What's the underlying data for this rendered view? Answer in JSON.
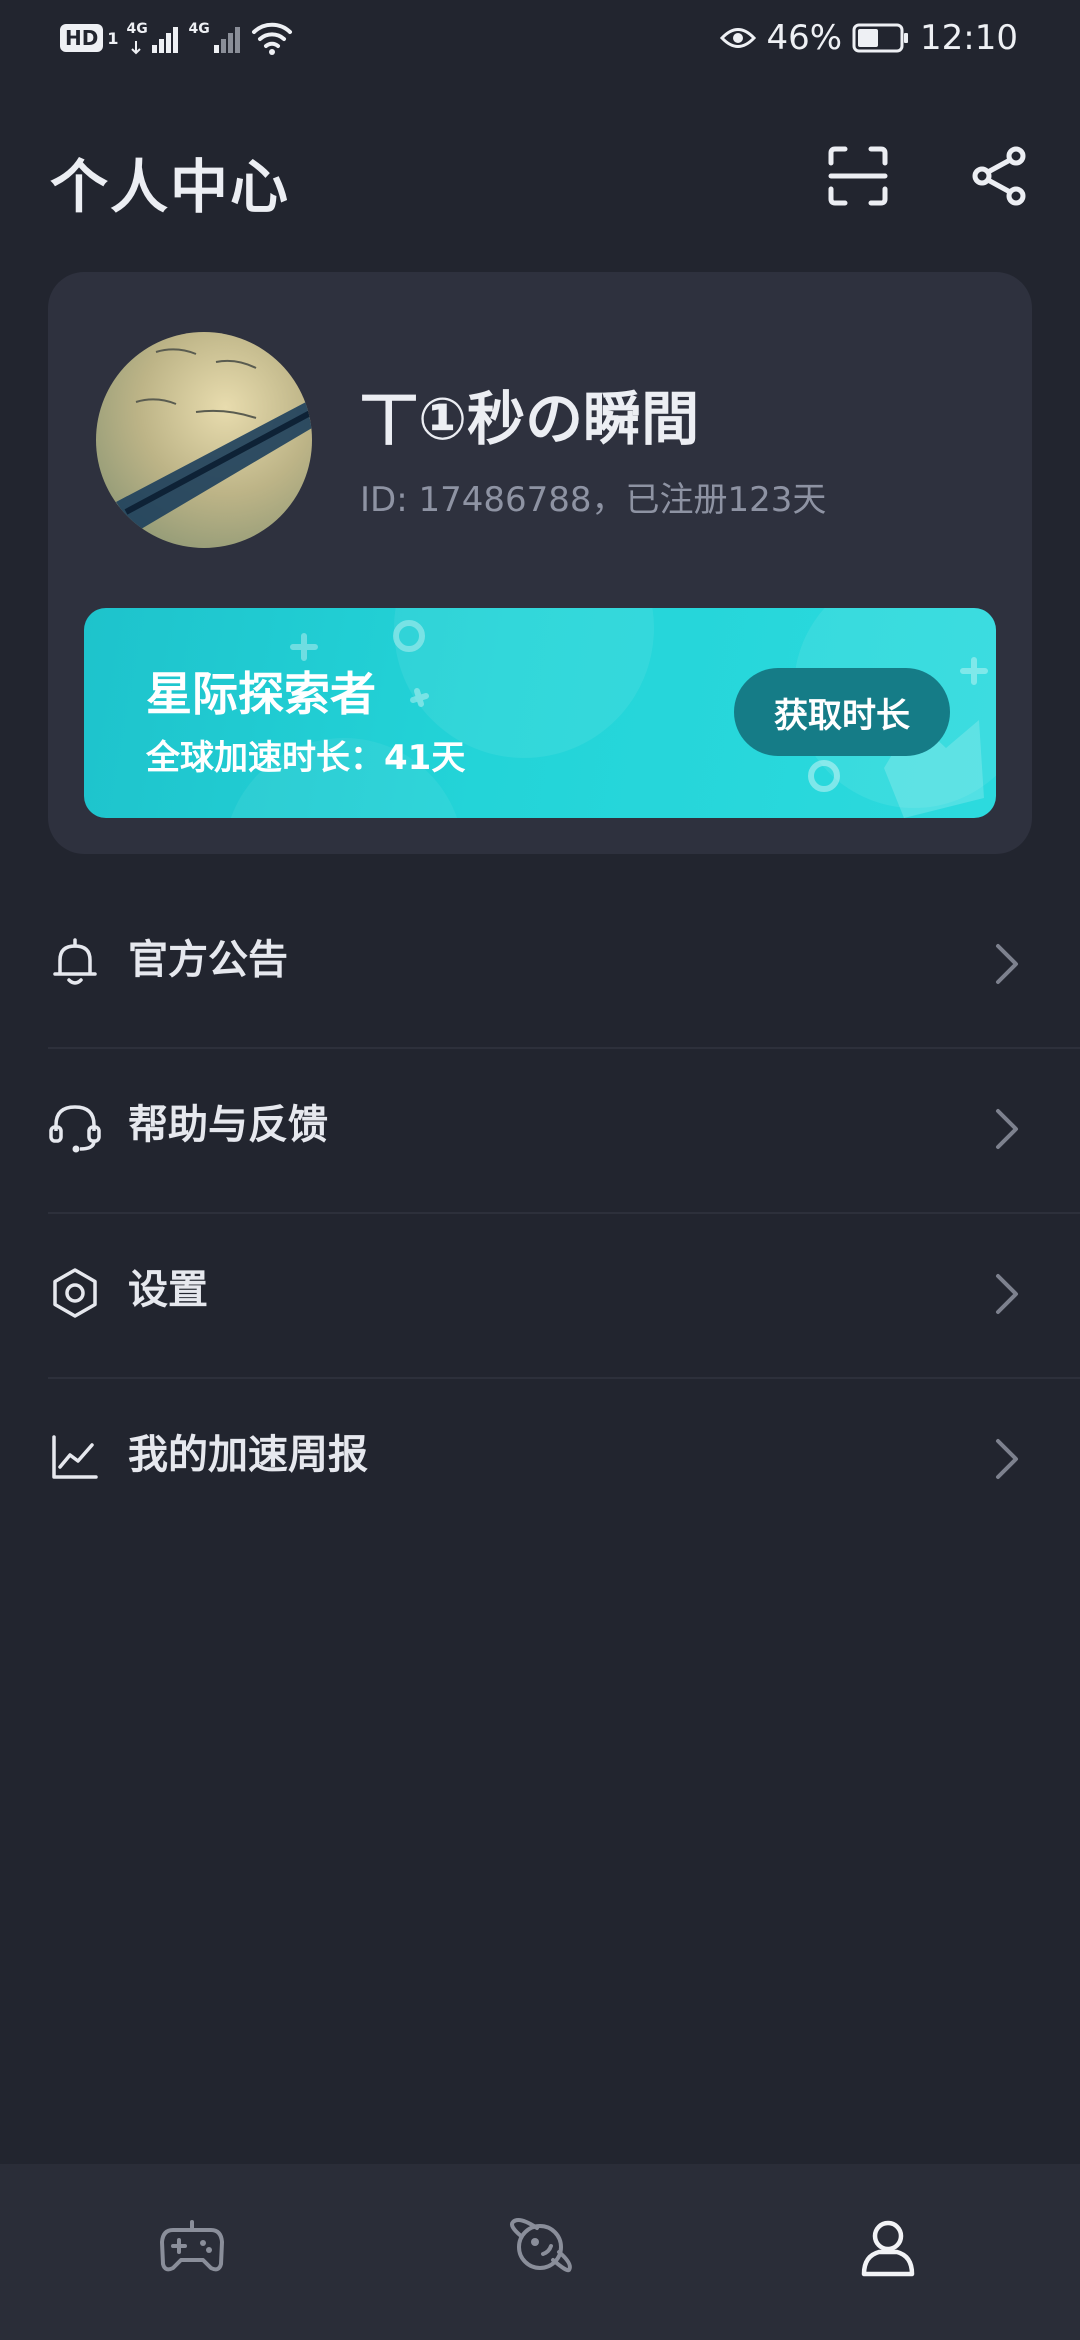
{
  "status_bar": {
    "hd_label": "HD",
    "sim_number": "1",
    "network_1": "4G",
    "network_2": "4G",
    "battery_percent": "46%",
    "time": "12:10",
    "icons": [
      "signal-icon",
      "wifi-icon",
      "eye-icon",
      "battery-icon"
    ]
  },
  "header": {
    "title": "个人中心",
    "scan_icon": "scan-icon",
    "share_icon": "share-icon"
  },
  "profile": {
    "username": "丅①秒の瞬間",
    "id_text": "ID: 17486788，已注册123天",
    "avatar_icon": "avatar-photo"
  },
  "vip": {
    "title": "星际探索者",
    "subtitle": "全球加速时长：41天",
    "button_label": "获取时长",
    "accent_color": "#23d4d8",
    "button_color": "#157c87"
  },
  "menu": {
    "items": [
      {
        "label": "官方公告",
        "icon": "bell-icon"
      },
      {
        "label": "帮助与反馈",
        "icon": "headset-icon"
      },
      {
        "label": "设置",
        "icon": "settings-icon"
      },
      {
        "label": "我的加速周报",
        "icon": "chart-icon"
      }
    ]
  },
  "bottom_nav": {
    "tabs": [
      {
        "icon": "gamepad-icon",
        "active": false
      },
      {
        "icon": "planet-icon",
        "active": false
      },
      {
        "icon": "user-icon",
        "active": true
      }
    ]
  },
  "colors": {
    "background": "#22252f",
    "card": "#2e313e",
    "text_primary": "#eceef3",
    "text_secondary": "#8e93a3"
  }
}
